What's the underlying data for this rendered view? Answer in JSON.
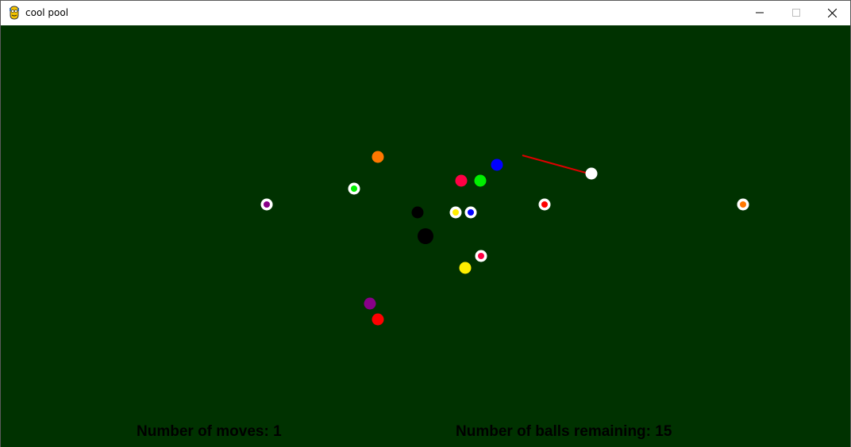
{
  "window": {
    "title": "cool pool",
    "app_icon": "pygame-snake-icon",
    "controls": [
      "minimize-icon",
      "maximize-icon",
      "close-icon"
    ]
  },
  "colors": {
    "table": "#003200",
    "cue_stick": "#dd0000",
    "cue_ball": "#ffffff",
    "pocket": "#000000",
    "hud_text": "#000000"
  },
  "hud": {
    "moves_label": "Number of moves: 1",
    "balls_label": "Number of balls remaining: 15"
  },
  "balls": [
    {
      "id": "cue-ball",
      "color": "#ffffff",
      "kind": "cue"
    },
    {
      "id": "orange-solid",
      "color": "#ff7700",
      "kind": "solid"
    },
    {
      "id": "blue-solid",
      "color": "#0000ff",
      "kind": "solid"
    },
    {
      "id": "crimson-solid",
      "color": "#ff0044",
      "kind": "solid"
    },
    {
      "id": "green-solid",
      "color": "#00ee00",
      "kind": "solid"
    },
    {
      "id": "black-solid",
      "color": "#000000",
      "kind": "solid"
    },
    {
      "id": "yellow-solid",
      "color": "#ffee00",
      "kind": "solid"
    },
    {
      "id": "purple-solid",
      "color": "#880088",
      "kind": "solid"
    },
    {
      "id": "red-solid",
      "color": "#ff0000",
      "kind": "solid"
    },
    {
      "id": "green-stripe",
      "color": "#00ee00",
      "kind": "stripe"
    },
    {
      "id": "purple-stripe",
      "color": "#880088",
      "kind": "stripe"
    },
    {
      "id": "yellow-stripe",
      "color": "#ffee00",
      "kind": "stripe"
    },
    {
      "id": "blue-stripe",
      "color": "#0000ff",
      "kind": "stripe"
    },
    {
      "id": "red-stripe",
      "color": "#ff0000",
      "kind": "stripe"
    },
    {
      "id": "orange-stripe",
      "color": "#ff7700",
      "kind": "stripe"
    },
    {
      "id": "crimson-stripe",
      "color": "#ff0044",
      "kind": "stripe"
    }
  ]
}
